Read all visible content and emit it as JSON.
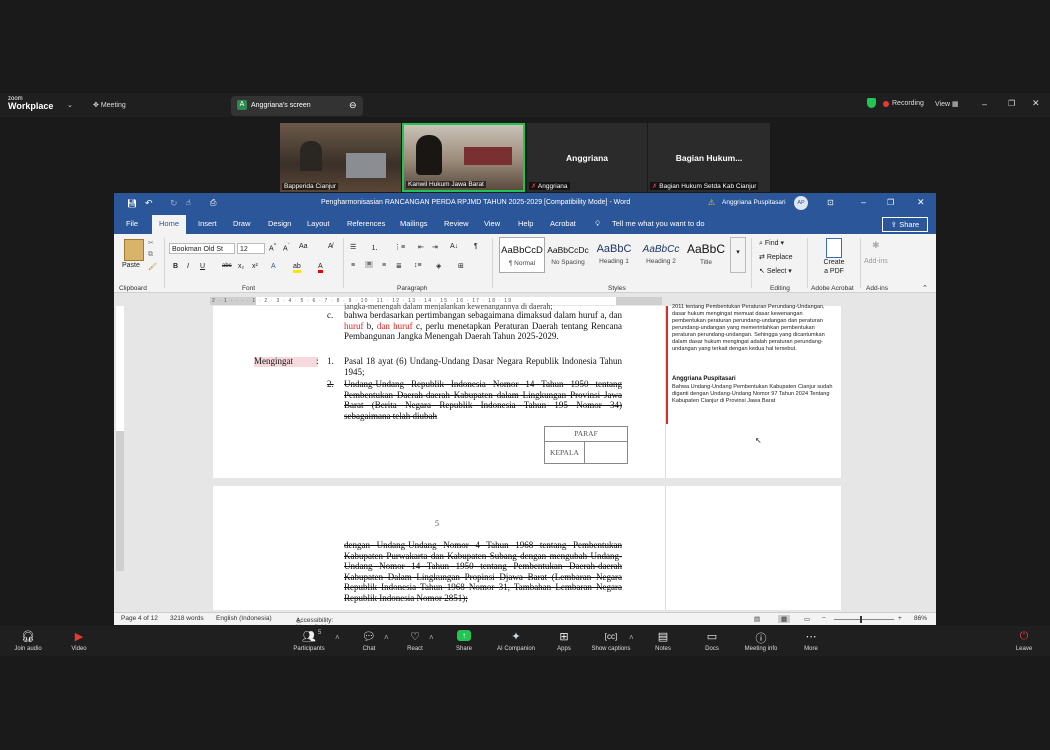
{
  "zoom": {
    "brand_small": "zoom",
    "brand_big": "Workplace",
    "meeting_label": "Meeting",
    "share_tab": "Anggriana's screen",
    "share_avatar": "A",
    "recording": "Recording",
    "view": "View",
    "tiles": [
      {
        "name": "Bapperida Cianjur"
      },
      {
        "name": "Kanwil Hukum Jawa Barat"
      },
      {
        "big": "Anggriana",
        "name": "Anggriana"
      },
      {
        "big": "Bagian  Hukum...",
        "name": "Bagian Hukum Setda Kab Cianjur"
      }
    ],
    "toolbar": {
      "join_audio": "Join audio",
      "video": "Video",
      "participants": "Participants",
      "participants_count": "5",
      "chat": "Chat",
      "react": "React",
      "share": "Share",
      "ai": "AI Companion",
      "apps": "Apps",
      "captions": "Show captions",
      "notes": "Notes",
      "docs": "Docs",
      "info": "Meeting info",
      "more": "More",
      "leave": "Leave"
    }
  },
  "word": {
    "title": "Pengharmonisasian RANCANGAN PERDA RPJMD TAHUN 2025-2029 [Compatibility Mode]  -  Word",
    "user": "Anggriana Puspitasari",
    "user_initials": "AP",
    "share_btn": "Share",
    "tabs": [
      "File",
      "Home",
      "Insert",
      "Draw",
      "Design",
      "Layout",
      "References",
      "Mailings",
      "Review",
      "View",
      "Help",
      "Acrobat"
    ],
    "tell_me": "Tell me what you want to do",
    "ribbon": {
      "paste": "Paste",
      "font_name": "Bookman Old St",
      "font_size": "12",
      "groups": {
        "clipboard": "Clipboard",
        "font": "Font",
        "paragraph": "Paragraph",
        "styles": "Styles",
        "editing": "Editing",
        "acrobat": "Adobe Acrobat",
        "addins": "Add-ins"
      },
      "styles": [
        {
          "preview": "AaBbCcD",
          "name": "¶ Normal"
        },
        {
          "preview": "AaBbCcDc",
          "name": "No Spacing"
        },
        {
          "preview": "AaBbC",
          "name": "Heading 1"
        },
        {
          "preview": "AaBbCc",
          "name": "Heading 2"
        },
        {
          "preview": "AaBbC",
          "name": "Title"
        }
      ],
      "find": "Find",
      "replace": "Replace",
      "select": "Select",
      "create_pdf_1": "Create",
      "create_pdf_2": "a PDF",
      "addins_btn": "Add-ins"
    },
    "ruler_marks": "2 · 1 · · · · 1 · 2 · 3 · 4 · 5 · 6 · 7 · 8 · 9 · 10 · 11 · 12 · 13 · 14 · 15 · 16 · 17 · 18 · 19",
    "page1": {
      "top_partial": "jangka-menengah dalam menjalankan kewenangannya di daerah;",
      "c_marker": "c.",
      "c_text_1": "bahwa berdasarkan pertimbangan sebagaimana dimaksud dalam huruf a, dan ",
      "c_red_1": "huruf",
      "c_text_2": " b, ",
      "c_red_2": "dan huruf",
      "c_text_3": " c, perlu menetapkan Peraturan Daerah tentang Rencana Pembangunan Jangka Menengah Daerah Tahun 2025-2029.",
      "mengingat": "Mengingat",
      "colon": ":",
      "item1_no": "1.",
      "item1": "Pasal 18 ayat (6) Undang-Undang Dasar Negara Republik Indonesia Tahun 1945;",
      "item2_no": "2.",
      "item2": "Undang-Undang Republik Indonesia Nomor 14 Tahun 1950 tentang Pembentukan Daerah-daerah Kabupaten dalam Lingkungan Provinsi Jawa Barat (Berita Negara Republik Indonesia Tahun 195 Nomor 34) sebagaimana telah diubah",
      "paraf": "PARAF",
      "kepala": "KEPALA"
    },
    "comments": {
      "c1_text": "2011 tentang Pembentukan Peraturan Perundang-Undangan, dasar hukum mengingat memuat dasar kewenangan pembentukan peraturan perundang-undangan dan peraturan perundang-undangan yang memerintahkan pembentukan peraturan perundang-undangan. Sehingga yang dicantumkan dalam dasar hukum  mengingat adalah peraturan perundang-undangan yang terkait dengan kedua hal tersebut.",
      "c2_author": "Anggriana Puspitasari",
      "c2_text": "Bahwa Undang-Undang Pembentukan Kabupaten Cianjur sudah diganti dengan Undang-Undang Nomor 97 Tahun 2024 Tentang Kabupaten Cianjur di Provinsi Jawa Barat"
    },
    "page2": {
      "page_no": "5",
      "text": "dengan Undang-Undang Nomor 4 Tahun 1968 tentang Pembentukan Kabupaten Purwakarta dan Kabupaten Subang dengan mengubah Undang-Undang Nomor 14 Tahun 1950 tentang Pembentukan Daerah-daerah Kabupaten Dalam Lingkungan Propinsi Djawa Barat (Lembaran Negara Republik Indonesia Tahun 1968 Nomor 31, Tambahan Lembaran Negara Republik Indonesia Nomor 2851);"
    },
    "status": {
      "page": "Page 4 of 12",
      "words": "3218 words",
      "lang": "English (Indonesia)",
      "access": "Accessibility: Unavailable",
      "zoom": "86%"
    }
  },
  "colors": {
    "word_blue": "#2b579a",
    "zoom_bg": "#1a1a1a",
    "red": "#d22222",
    "share_green": "#23c552"
  }
}
